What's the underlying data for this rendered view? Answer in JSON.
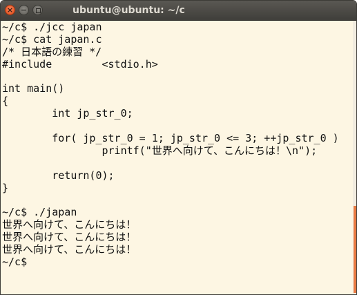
{
  "window": {
    "title": "ubuntu@ubuntu: ~/c",
    "close_glyph": "×",
    "minimize_glyph": "−",
    "close_icon": "close-icon",
    "minimize_icon": "minimize-icon",
    "maximize_icon": "maximize-icon"
  },
  "colors": {
    "terminal_background": "#fdf6e3",
    "text": "#111111",
    "titlebar": "#3f3e3a",
    "close_button": "#df4a16",
    "scroll_thumb": "#e97b43"
  },
  "terminal": {
    "lines": [
      "~/c$ ./jcc japan",
      "~/c$ cat japan.c",
      "/* 日本語の練習 */",
      "#include        <stdio.h>",
      "",
      "int main()",
      "{",
      "        int jp_str_0;",
      "",
      "        for( jp_str_0 = 1; jp_str_0 <= 3; ++jp_str_0 )",
      "                printf(\"世界へ向けて、こんにちは！\\n\");",
      "",
      "        return(0);",
      "}",
      "",
      "~/c$ ./japan",
      "世界へ向けて、こんにちは！",
      "世界へ向けて、こんにちは！",
      "世界へ向けて、こんにちは！",
      "~/c$"
    ]
  }
}
